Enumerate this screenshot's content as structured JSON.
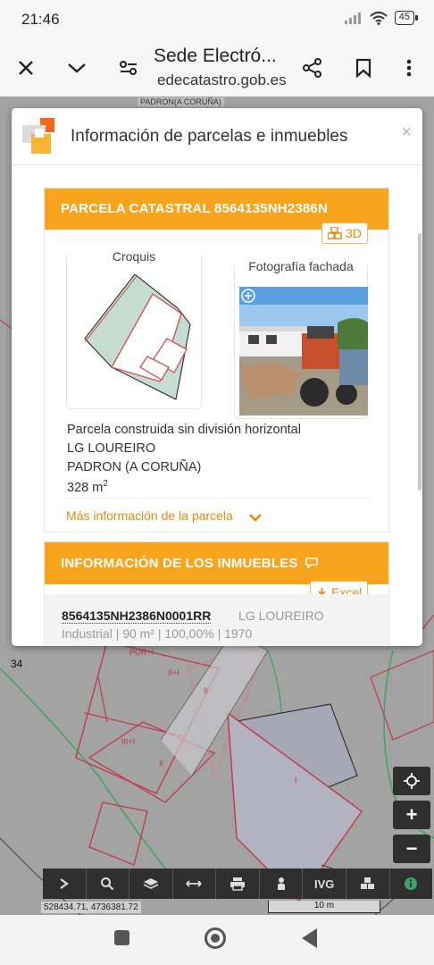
{
  "status_bar": {
    "time": "21:46",
    "battery": "45"
  },
  "browser": {
    "title": "Sede Electró...",
    "url": "edecatastro.gob.es"
  },
  "map": {
    "top_label": "PADRON(A CORUÑA)",
    "side_number": "34",
    "plot_labels": [
      "POR+I",
      "II+I",
      "II",
      "III+I",
      "II",
      "I"
    ],
    "toolbar_labels": [
      "IVG"
    ],
    "coordinates": "528434.71, 4736381.72",
    "scale": "10 m"
  },
  "modal": {
    "title": "Información de parcelas e inmuebles",
    "close": "×",
    "parcel": {
      "header": "PARCELA CATASTRAL 8564135NH2386N",
      "button_3d": "3D",
      "sketch_label": "Croquis",
      "photo_label": "Fotografía fachada",
      "description": "Parcela construida sin división horizontal",
      "locality": "LG LOUREIRO",
      "municipality": "PADRON (A CORUÑA)",
      "area_value": "328 m",
      "area_unit_sup": "2",
      "more_info": "Más información de la parcela"
    },
    "properties": {
      "header": "INFORMACIÓN DE LOS INMUEBLES",
      "excel": "Excel",
      "rows": [
        {
          "reference": "8564135NH2386N0001RR",
          "address": "LG LOUREIRO",
          "meta": "Industrial | 90 m² | 100,00% | 1970"
        }
      ]
    }
  },
  "colors": {
    "accent": "#f8a51d",
    "link": "#e58a0f",
    "parcel_fill": "#c5dcd0",
    "parcel_line": "#d84a57"
  }
}
